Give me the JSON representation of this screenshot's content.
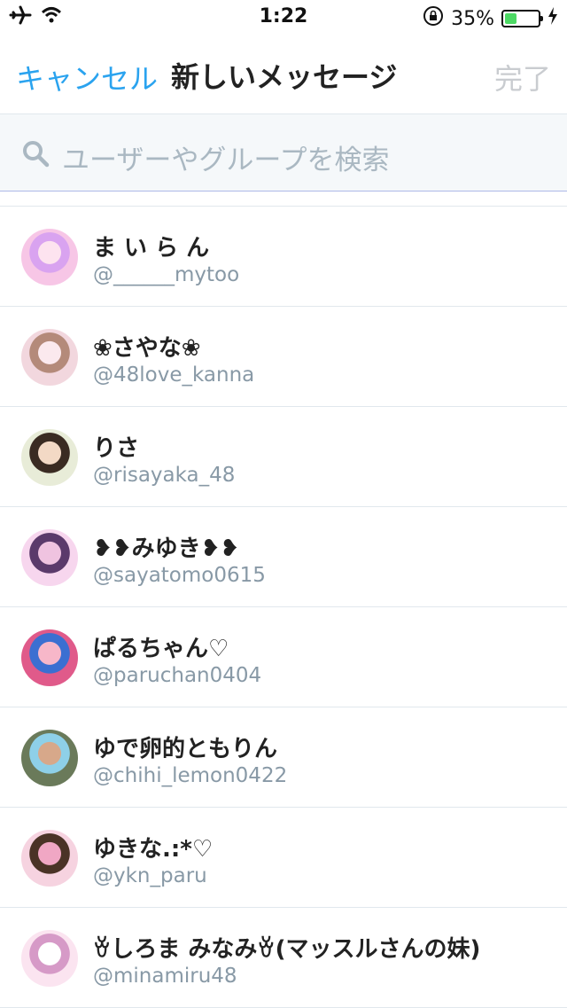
{
  "status_bar": {
    "time": "1:22",
    "battery_percent": "35%",
    "battery_level": 0.35
  },
  "navbar": {
    "cancel": "キャンセル",
    "title": "新しいメッセージ",
    "done": "完了"
  },
  "search": {
    "placeholder": "ユーザーやグループを検索"
  },
  "users": [
    {
      "name": "ま い ら ん",
      "handle": "@______mytoo",
      "colors": [
        "#f7c6e6",
        "#d9a3f0",
        "#fde3ef"
      ]
    },
    {
      "name": "❀さやな❀",
      "handle": "@48love_kanna",
      "colors": [
        "#f2d7de",
        "#b48a7a",
        "#fbe9ee"
      ]
    },
    {
      "name": "りさ",
      "handle": "@risayaka_48",
      "colors": [
        "#e8ecd8",
        "#3a2b22",
        "#f3d9c5"
      ]
    },
    {
      "name": "❥❥みゆき❥❥",
      "handle": "@sayatomo0615",
      "colors": [
        "#f7d6ee",
        "#5b3a6b",
        "#efc3e0"
      ]
    },
    {
      "name": "ぱるちゃん♡",
      "handle": "@paruchan0404",
      "colors": [
        "#e05a8a",
        "#3b6fd1",
        "#f7b7c9"
      ]
    },
    {
      "name": "ゆで卵的ともりん",
      "handle": "@chihi_lemon0422",
      "colors": [
        "#6a7a5a",
        "#8ed0e8",
        "#d7a88a"
      ]
    },
    {
      "name": "ゆきな.:*♡",
      "handle": "@ykn_paru",
      "colors": [
        "#f6d3e0",
        "#4a3326",
        "#f0a7c4"
      ]
    },
    {
      "name": "ꈊしろま みなみꈊ(マッスルさんの妹)",
      "handle": "@minamiru48",
      "colors": [
        "#fbe4f0",
        "#d69ac7",
        "#ffffff"
      ]
    }
  ]
}
